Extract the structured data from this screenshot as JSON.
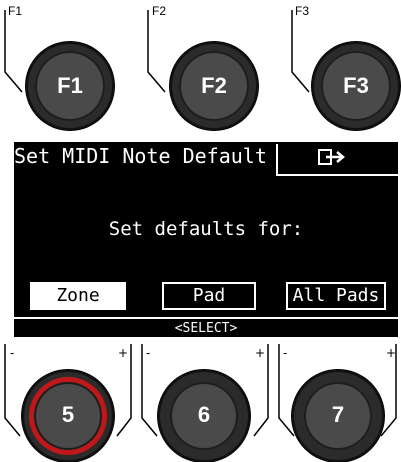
{
  "function_keys": [
    {
      "label": "F1",
      "cap": "F1"
    },
    {
      "label": "F2",
      "cap": "F2"
    },
    {
      "label": "F3",
      "cap": "F3"
    }
  ],
  "display": {
    "title": "Set MIDI Note Default",
    "exit_icon": "exit-icon",
    "message": "Set defaults for:",
    "options": [
      "Zone",
      "Pad",
      "All Pads"
    ],
    "selected_option": "Zone",
    "select_hint": "<SELECT>"
  },
  "encoders": [
    {
      "value": "5",
      "minus": "-",
      "plus": "+",
      "highlight": "#c0171b"
    },
    {
      "value": "6",
      "minus": "-",
      "plus": "+"
    },
    {
      "value": "7",
      "minus": "-",
      "plus": "+"
    }
  ],
  "colors": {
    "accent_ring": "#c0171b",
    "lcd_bg": "#000000",
    "lcd_fg": "#ffffff"
  }
}
